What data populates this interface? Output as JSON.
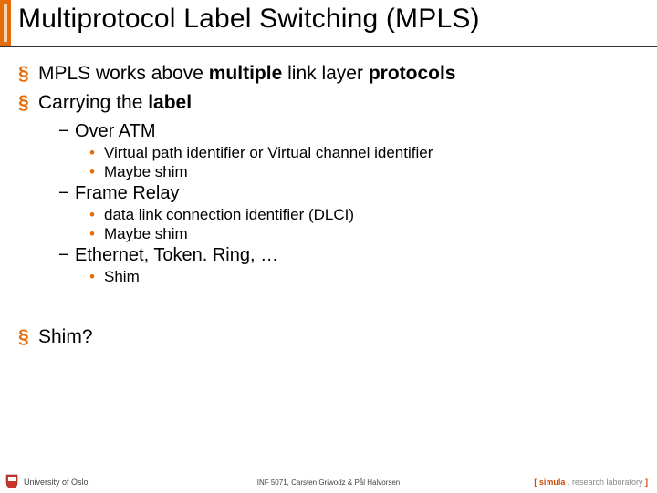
{
  "title": "Multiprotocol Label Switching (MPLS)",
  "bullets": [
    {
      "pre": "MPLS works above ",
      "b1": "multiple",
      "mid": " link layer ",
      "b2": "protocols"
    },
    {
      "pre": "Carrying the ",
      "b1": "label",
      "sub": [
        {
          "text": "Over ATM",
          "sub": [
            "Virtual path identifier or Virtual channel identifier",
            "Maybe shim"
          ]
        },
        {
          "text": "Frame Relay",
          "sub": [
            "data link connection identifier (DLCI)",
            "Maybe shim"
          ]
        },
        {
          "text": "Ethernet, Token. Ring, …",
          "sub": [
            "Shim"
          ]
        }
      ]
    },
    {
      "text": "Shim?"
    }
  ],
  "footer": {
    "left": "University of Oslo",
    "center": "INF 5071, Carsten Griwodz & Pål Halvorsen",
    "right": {
      "br_open": "[ ",
      "brand": "simula",
      "dot": " . ",
      "sub": "research laboratory",
      "br_close": " ]"
    }
  },
  "colors": {
    "accent": "#e56c0a"
  }
}
